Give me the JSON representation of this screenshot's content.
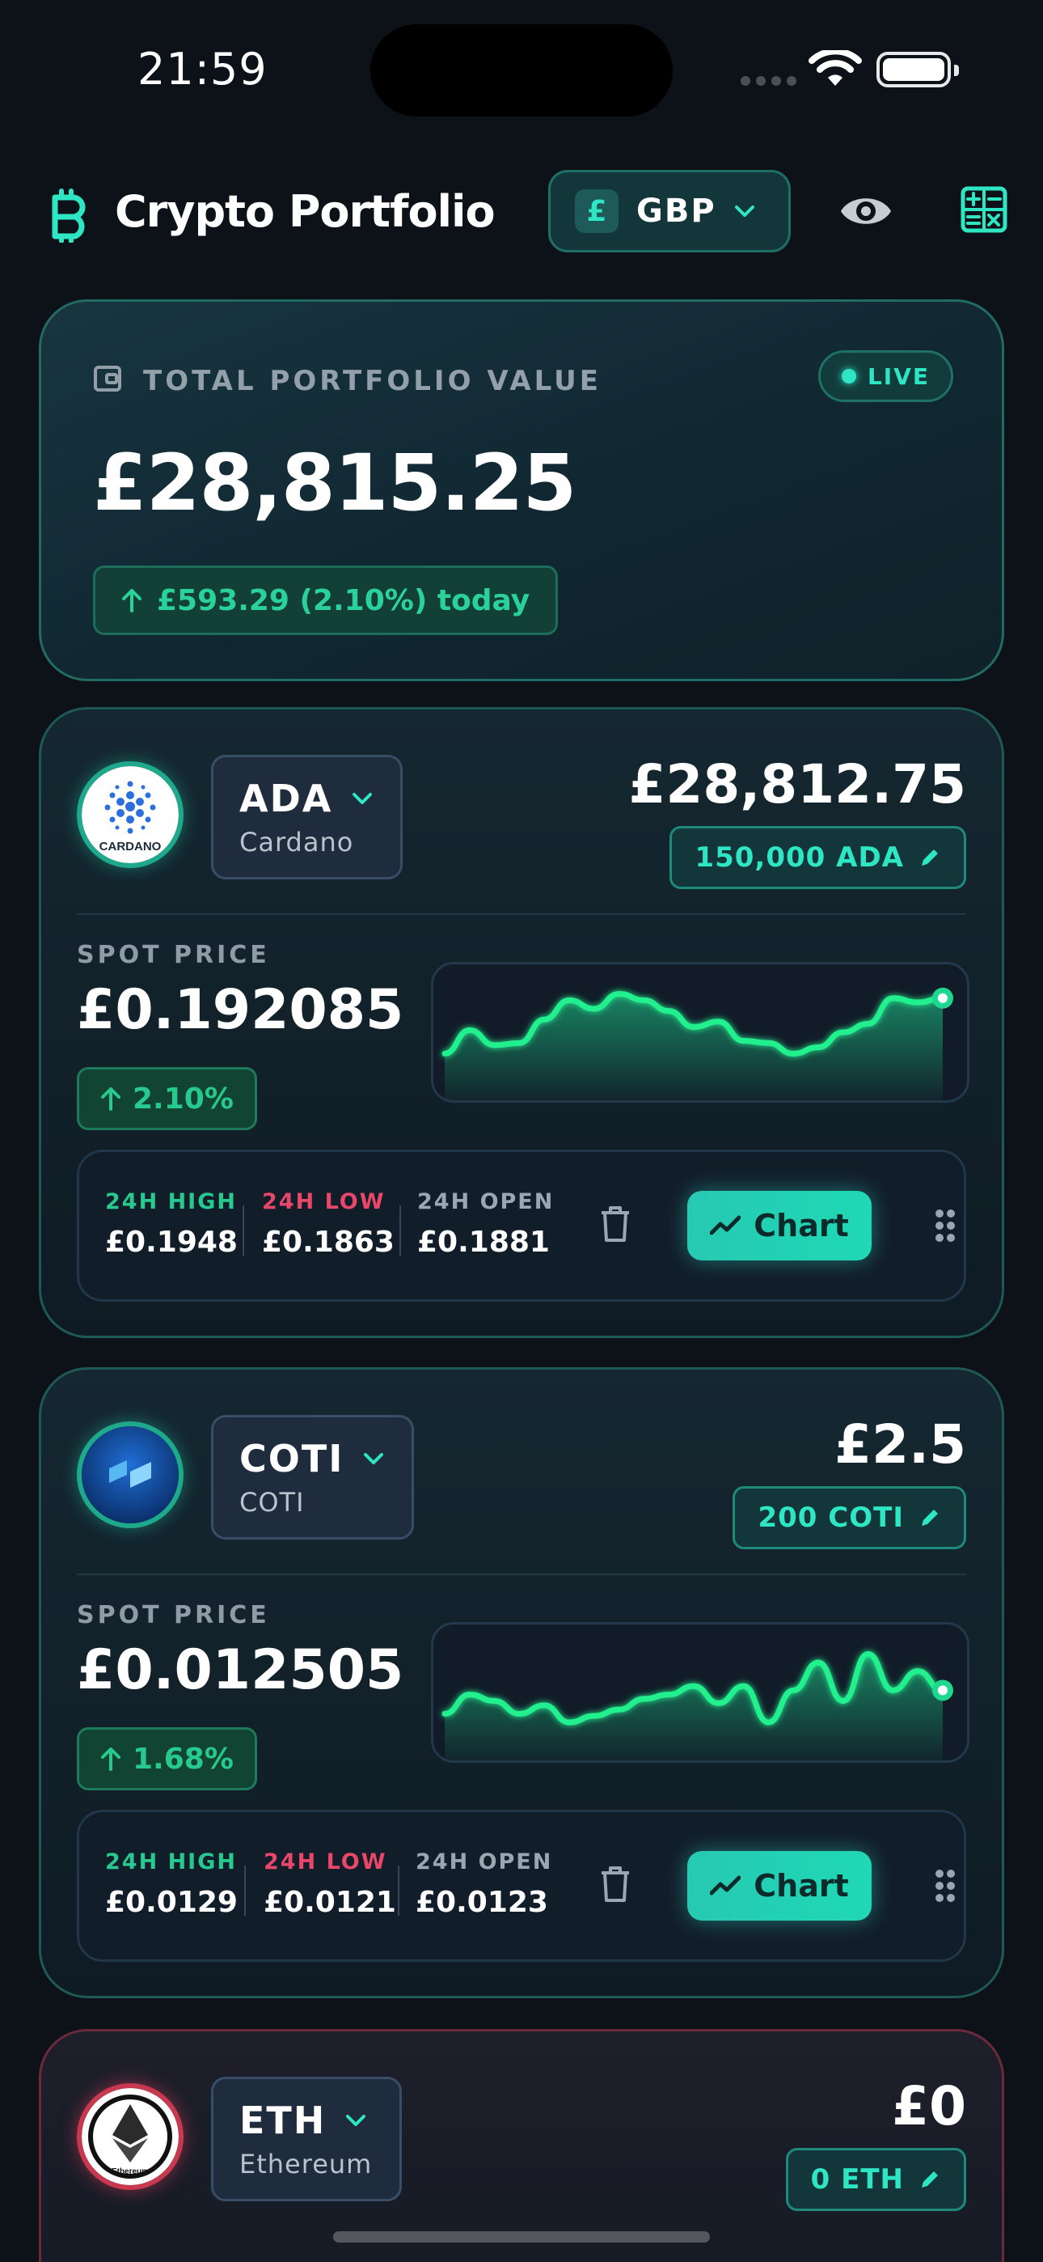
{
  "status_bar": {
    "time": "21:59"
  },
  "header": {
    "app_icon": "bitcoin-icon",
    "title": "Crypto Portfolio",
    "currency_symbol": "£",
    "currency_code": "GBP"
  },
  "portfolio": {
    "label": "TOTAL PORTFOLIO VALUE",
    "live_label": "LIVE",
    "total_value": "£28,815.25",
    "today_change": "£593.29 (2.10%) today"
  },
  "coins": [
    {
      "symbol": "ADA",
      "name": "Cardano",
      "logo_text": "CARDANO",
      "value": "£28,812.75",
      "quantity": "150,000 ADA",
      "spot_label": "SPOT PRICE",
      "spot_price": "£0.192085",
      "change_pct": "2.10%",
      "high_label": "24H HIGH",
      "high": "£0.1948",
      "low_label": "24H LOW",
      "low": "£0.1863",
      "open_label": "24H OPEN",
      "open": "£0.1881",
      "chart_label": "Chart",
      "sparkline": [
        0.3,
        0.52,
        0.38,
        0.4,
        0.62,
        0.8,
        0.72,
        0.86,
        0.8,
        0.7,
        0.55,
        0.6,
        0.42,
        0.4,
        0.3,
        0.36,
        0.5,
        0.58,
        0.82,
        0.78,
        0.82
      ]
    },
    {
      "symbol": "COTI",
      "name": "COTI",
      "value": "£2.5",
      "quantity": "200 COTI",
      "spot_label": "SPOT PRICE",
      "spot_price": "£0.012505",
      "change_pct": "1.68%",
      "high_label": "24H HIGH",
      "high": "£0.0129",
      "low_label": "24H LOW",
      "low": "£0.0121",
      "open_label": "24H OPEN",
      "open": "£0.0123",
      "chart_label": "Chart",
      "sparkline": [
        0.3,
        0.48,
        0.42,
        0.3,
        0.38,
        0.22,
        0.28,
        0.34,
        0.44,
        0.48,
        0.56,
        0.4,
        0.56,
        0.22,
        0.52,
        0.78,
        0.42,
        0.86,
        0.52,
        0.7,
        0.52
      ]
    },
    {
      "symbol": "ETH",
      "name": "Ethereum",
      "logo_text": "Ethereum",
      "value": "£0",
      "quantity": "0 ETH"
    }
  ],
  "colors": {
    "accent": "#2ee6c3",
    "positive": "#27c98e",
    "negative": "#e8476a",
    "background": "#0c1218"
  }
}
